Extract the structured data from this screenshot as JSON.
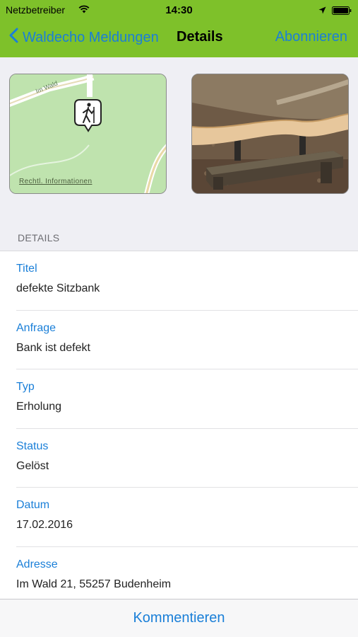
{
  "status_bar": {
    "carrier": "Netzbetreiber",
    "time": "14:30"
  },
  "nav": {
    "back_label": "Waldecho Meldungen",
    "title": "Details",
    "subscribe_label": "Abonnieren"
  },
  "map": {
    "street_label": "Im Wald",
    "legal_link": "Rechtl. Informationen",
    "pin_icon": "hiker-icon"
  },
  "section": {
    "header": "DETAILS"
  },
  "details": [
    {
      "label": "Titel",
      "value": "defekte Sitzbank"
    },
    {
      "label": "Anfrage",
      "value": "Bank ist defekt"
    },
    {
      "label": "Typ",
      "value": "Erholung"
    },
    {
      "label": "Status",
      "value": "Gelöst"
    },
    {
      "label": "Datum",
      "value": "17.02.2016"
    },
    {
      "label": "Adresse",
      "value": "Im Wald 21, 55257 Budenheim"
    }
  ],
  "toolbar": {
    "comment_label": "Kommentieren"
  },
  "colors": {
    "nav_green": "#7ec12a",
    "link_blue": "#1a7fd8"
  }
}
